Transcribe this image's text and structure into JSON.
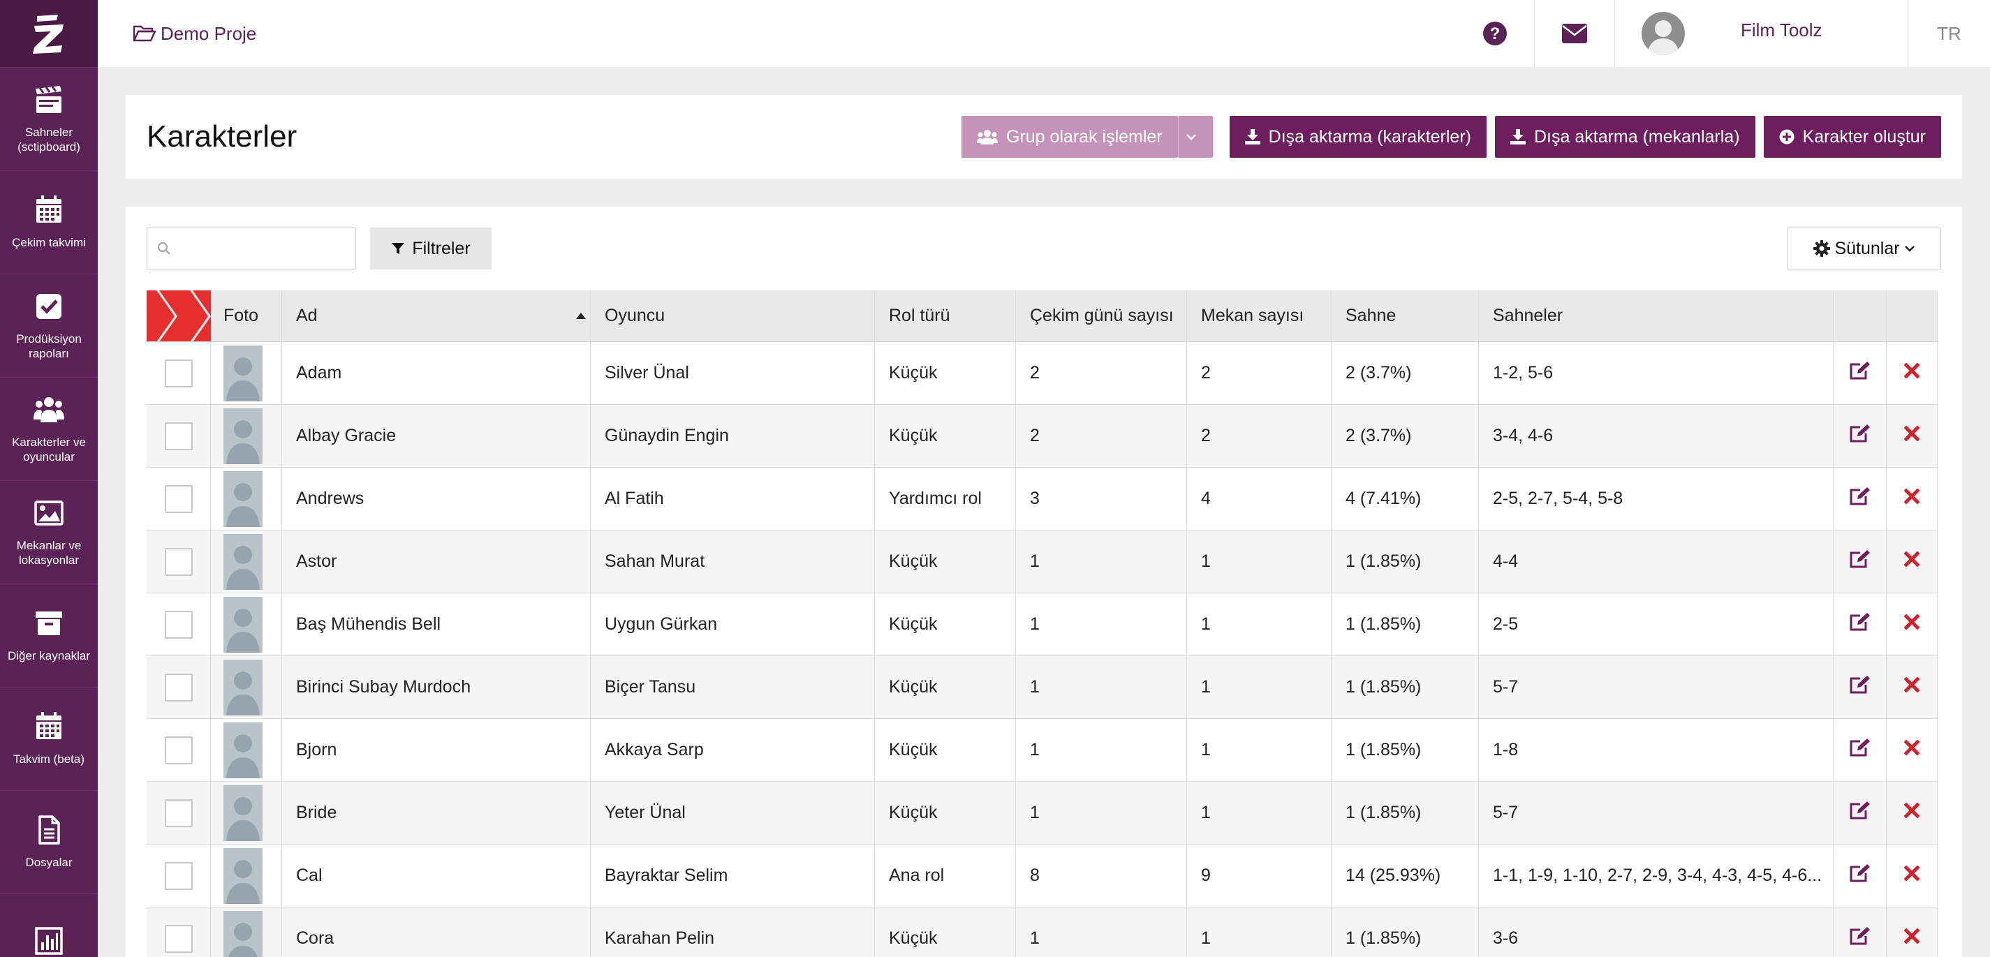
{
  "sidebar": {
    "logo": "logo-z",
    "items": [
      {
        "label": "Sahneler (sctipboard)",
        "icon": "clapperboard-icon"
      },
      {
        "label": "Çekim takvimi",
        "icon": "calendar-icon"
      },
      {
        "label": "Prodüksiyon rapoları",
        "icon": "checkbox-icon"
      },
      {
        "label": "Karakterler ve oyuncular",
        "icon": "users-icon"
      },
      {
        "label": "Mekanlar ve lokasyonlar",
        "icon": "image-icon"
      },
      {
        "label": "Diğer kaynaklar",
        "icon": "archive-icon"
      },
      {
        "label": "Takvim (beta)",
        "icon": "calendar-icon"
      },
      {
        "label": "Dosyalar",
        "icon": "document-icon"
      },
      {
        "label": "",
        "icon": "bar-chart-icon"
      }
    ]
  },
  "topbar": {
    "project": "Demo Proje",
    "user_name": "Film Toolz",
    "language": "TR"
  },
  "header": {
    "title": "Karakterler",
    "group_button": "Grup olarak işlemler",
    "export_characters": "Dışa aktarma (karakterler)",
    "export_locations": "Dışa aktarma (mekanlarla)",
    "create_character": "Karakter oluştur"
  },
  "toolbar": {
    "search_placeholder": "",
    "filters_label": "Filtreler",
    "columns_label": "Sütunlar"
  },
  "colors": {
    "sidebar": "#5b2255",
    "accent": "#6e1e5f",
    "accent_light": "#c593b9",
    "delete": "#d0212d",
    "arrow": "#e62d2d"
  },
  "table": {
    "columns": [
      "Foto",
      "Ad",
      "Oyuncu",
      "Rol türü",
      "Çekim günü sayısı",
      "Mekan sayısı",
      "Sahne",
      "Sahneler"
    ],
    "sort": {
      "column": "Ad",
      "direction": "asc"
    },
    "rows": [
      {
        "ad": "Adam",
        "oyuncu": "Silver Ünal",
        "rol": "Küçük",
        "gun": "2",
        "mekan": "2",
        "sahne": "2 (3.7%)",
        "sahneler": "1-2, 5-6"
      },
      {
        "ad": "Albay Gracie",
        "oyuncu": "Günaydin Engin",
        "rol": "Küçük",
        "gun": "2",
        "mekan": "2",
        "sahne": "2 (3.7%)",
        "sahneler": "3-4, 4-6"
      },
      {
        "ad": "Andrews",
        "oyuncu": "Al Fatih",
        "rol": "Yardımcı rol",
        "gun": "3",
        "mekan": "4",
        "sahne": "4 (7.41%)",
        "sahneler": "2-5, 2-7, 5-4, 5-8"
      },
      {
        "ad": "Astor",
        "oyuncu": "Sahan Murat",
        "rol": "Küçük",
        "gun": "1",
        "mekan": "1",
        "sahne": "1 (1.85%)",
        "sahneler": "4-4"
      },
      {
        "ad": "Baş Mühendis Bell",
        "oyuncu": "Uygun Gürkan",
        "rol": "Küçük",
        "gun": "1",
        "mekan": "1",
        "sahne": "1 (1.85%)",
        "sahneler": "2-5"
      },
      {
        "ad": "Birinci Subay Murdoch",
        "oyuncu": "Biçer Tansu",
        "rol": "Küçük",
        "gun": "1",
        "mekan": "1",
        "sahne": "1 (1.85%)",
        "sahneler": "5-7"
      },
      {
        "ad": "Bjorn",
        "oyuncu": "Akkaya Sarp",
        "rol": "Küçük",
        "gun": "1",
        "mekan": "1",
        "sahne": "1 (1.85%)",
        "sahneler": "1-8"
      },
      {
        "ad": "Bride",
        "oyuncu": "Yeter Ünal",
        "rol": "Küçük",
        "gun": "1",
        "mekan": "1",
        "sahne": "1 (1.85%)",
        "sahneler": "5-7"
      },
      {
        "ad": "Cal",
        "oyuncu": "Bayraktar Selim",
        "rol": "Ana rol",
        "gun": "8",
        "mekan": "9",
        "sahne": "14 (25.93%)",
        "sahneler": "1-1, 1-9, 1-10, 2-7, 2-9, 3-4, 4-3, 4-5, 4-6..."
      },
      {
        "ad": "Cora",
        "oyuncu": "Karahan Pelin",
        "rol": "Küçük",
        "gun": "1",
        "mekan": "1",
        "sahne": "1 (1.85%)",
        "sahneler": "3-6"
      }
    ]
  }
}
